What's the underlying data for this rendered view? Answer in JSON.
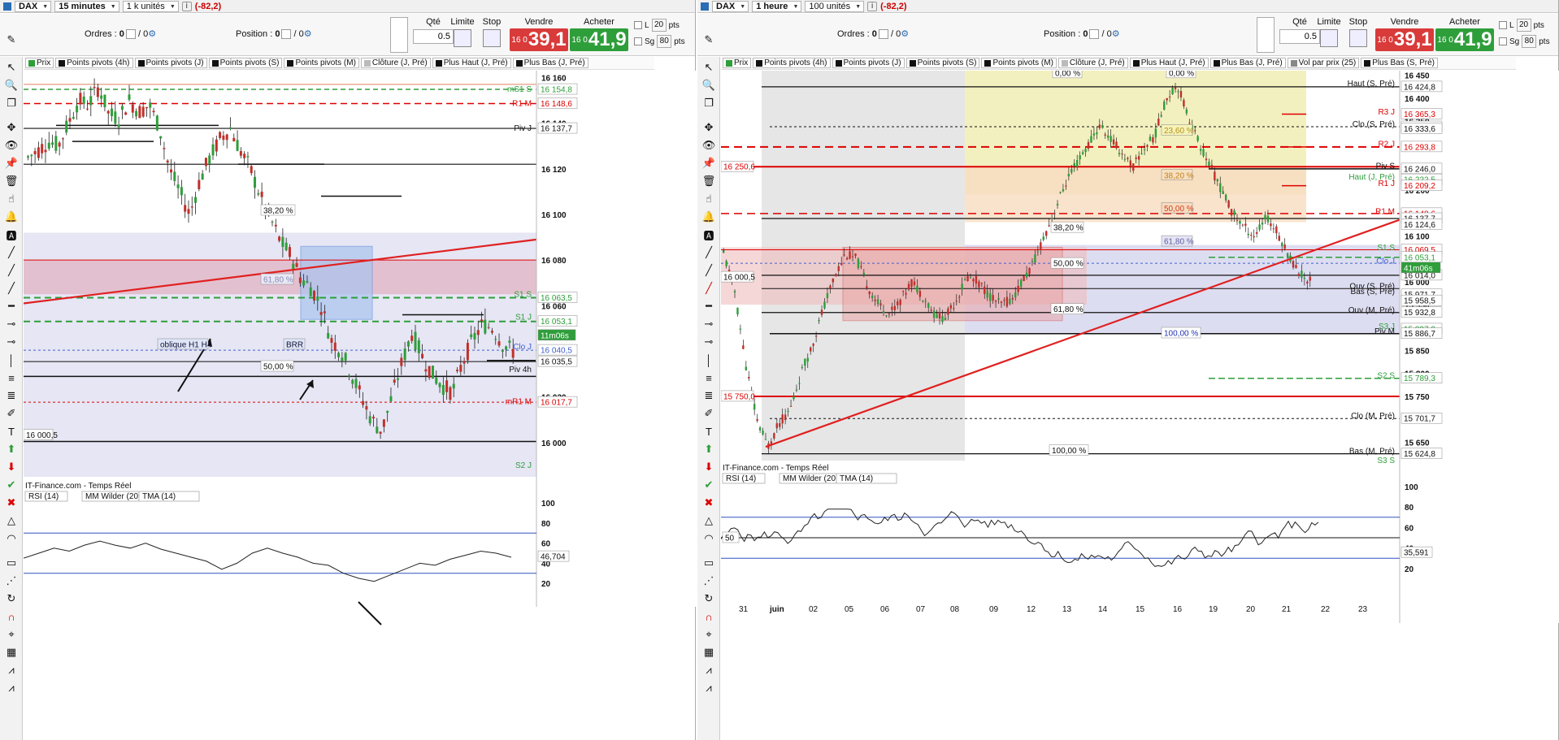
{
  "left": {
    "instrument": "DAX",
    "timeframe": "15 minutes",
    "units": "1 k unités",
    "pnl": "(-82,2)",
    "orders_label": "Ordres :",
    "orders_value": "0",
    "orders_slash": "/ 0",
    "position_label": "Position :",
    "position_value": "0",
    "position_slash": "/ 0",
    "qty_label": "Qté",
    "qty_value": "0.5",
    "limit_label": "Limite",
    "stop_label": "Stop",
    "sell_label": "Vendre",
    "sell_prefix": "16 0",
    "sell_price": "39,1",
    "buy_label": "Acheter",
    "buy_prefix": "16 0",
    "buy_price": "41,9",
    "opt_l": "L",
    "opt_sg": "Sg",
    "pts1": "20",
    "pts2": "80",
    "pts_label": "pts",
    "legend": [
      "Prix",
      "Points pivots (4h)",
      "Points pivots (J)",
      "Points pivots (S)",
      "Points pivots (M)",
      "Clôture (J, Pré)",
      "Plus Haut (J, Pré)",
      "Plus Bas (J, Pré)"
    ],
    "feed": "IT-Finance.com - Temps Réel",
    "rsi_legend": [
      "RSI (14)",
      "MM Wilder (20)",
      "TMA (14)"
    ],
    "rsi_value": "46,704",
    "price_axis": [
      "16 160",
      "16 140",
      "16 120",
      "16 100",
      "16 080",
      "16 060",
      "16 040",
      "16 020",
      "16 000"
    ],
    "rsi_axis": [
      "100",
      "80",
      "60",
      "40",
      "20"
    ],
    "level_tags": [
      "16 154,8",
      "16 148,6",
      "16 137,7",
      "16 063,5",
      "16 053,1",
      "16 040,5",
      "16 035,5",
      "16 017,7"
    ],
    "level_labels": [
      "mS1 S",
      "R1 M",
      "Piv J",
      "S1 S",
      "S1 J",
      "Clo J",
      "Piv 4h",
      "mR1 M",
      "S2 J"
    ],
    "pct_labels": [
      "38,20 %",
      "61,80 %",
      "50,00 %",
      "50,00 %"
    ],
    "left_tag": "16 000,5",
    "countdown": "11m06s",
    "annot1": "oblique H1 H4",
    "annot2": "BRR"
  },
  "right": {
    "instrument": "DAX",
    "timeframe": "1 heure",
    "units": "100 unités",
    "pnl": "(-82,2)",
    "orders_label": "Ordres :",
    "orders_value": "0",
    "orders_slash": "/ 0",
    "position_label": "Position :",
    "position_value": "0",
    "position_slash": "/ 0",
    "qty_label": "Qté",
    "qty_value": "0.5",
    "limit_label": "Limite",
    "stop_label": "Stop",
    "sell_label": "Vendre",
    "sell_prefix": "16 0",
    "sell_price": "39,1",
    "buy_label": "Acheter",
    "buy_prefix": "16 0",
    "buy_price": "41,9",
    "opt_l": "L",
    "opt_sg": "Sg",
    "pts1": "20",
    "pts2": "80",
    "pts_label": "pts",
    "legend": [
      "Prix",
      "Points pivots (4h)",
      "Points pivots (J)",
      "Points pivots (S)",
      "Points pivots (M)",
      "Clôture (J, Pré)",
      "Plus Haut (J, Pré)",
      "Plus Bas (J, Pré)",
      "Vol par prix (25)",
      "Plus Bas (S, Pré)"
    ],
    "feed": "IT-Finance.com - Temps Réel",
    "rsi_legend": [
      "RSI (14)",
      "MM Wilder (20)",
      "TMA (14)"
    ],
    "rsi_value": "35,591",
    "rsi_left_tag": "50",
    "price_axis": [
      "16 450",
      "16 400",
      "16 350",
      "16 300",
      "16 250",
      "16 200",
      "16 150",
      "16 100",
      "16 050",
      "16 000",
      "15 950",
      "15 900",
      "15 850",
      "15 800",
      "15 750",
      "15 700",
      "15 650"
    ],
    "rsi_axis": [
      "100",
      "80",
      "60",
      "40",
      "20"
    ],
    "date_axis": [
      "31",
      "juin",
      "02",
      "05",
      "06",
      "07",
      "08",
      "09",
      "12",
      "13",
      "14",
      "15",
      "16",
      "19",
      "20",
      "21",
      "22",
      "23"
    ],
    "level_tags": [
      "16 424,8",
      "16 365,3",
      "16 337,8",
      "16 333,6",
      "16 293,8",
      "16 246,0",
      "16 222,5",
      "16 209,2",
      "16 148,6",
      "16 137,7",
      "16 124,6",
      "16 069,5",
      "16 053,1",
      "16 014,0",
      "15 971,7",
      "15 958,5",
      "15 932,8",
      "15 897,0",
      "15 886,7",
      "15 789,3",
      "15 701,7",
      "15 624,8"
    ],
    "level_labels": [
      "Haut (S, Pré)",
      "R3 J",
      "Clo (S, Pré)",
      "R2 J",
      "Piv S",
      "Haut (J, Pré)",
      "R1 J",
      "R1 M",
      "S1 S",
      "Clo J",
      "Ouv (S, Pré)",
      "Bas (S, Pré)",
      "Ouv (M, Pré)",
      "S3 J",
      "Piv M",
      "S2 S",
      "Clo (M, Pré)",
      "Bas (M, Pré)",
      "S3 S"
    ],
    "pct_top": [
      "0,00 %",
      "0,00 %"
    ],
    "pct_labels": [
      "23,60 %",
      "38,20 %",
      "50,00 %",
      "61,80 %",
      "38,20 %",
      "50,00 %",
      "61,80 %",
      "100,00 %",
      "100,00 %"
    ],
    "left_tags": [
      "16 250,6",
      "16 000,5",
      "15 750,0"
    ],
    "countdown": "41m06s"
  }
}
